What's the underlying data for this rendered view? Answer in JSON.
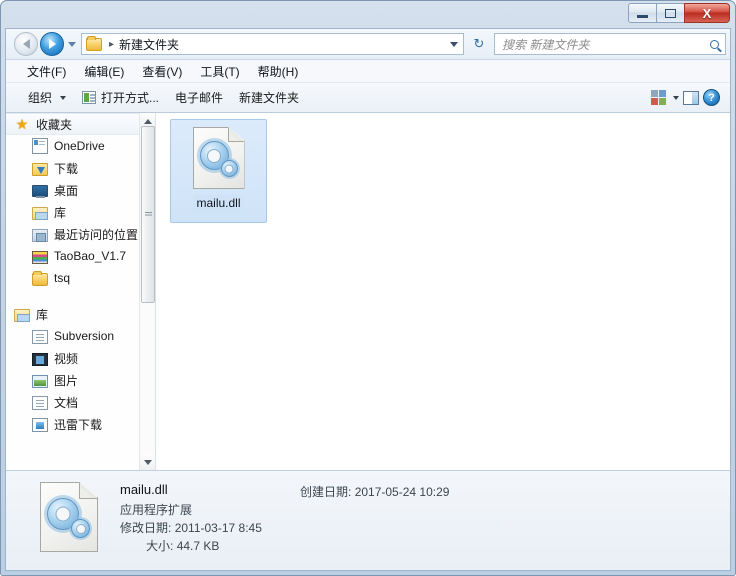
{
  "window": {
    "minimize_label": "Minimize",
    "maximize_label": "Maximize",
    "close_label": "X"
  },
  "address_bar": {
    "back_label": "Back",
    "forward_label": "Forward",
    "recent_label": "Recent pages",
    "crumb_separator": "▸",
    "path_label": "新建文件夹",
    "dropdown_label": "Previous locations",
    "refresh_label": "↻"
  },
  "search": {
    "placeholder": "搜索 新建文件夹",
    "value": ""
  },
  "menubar": {
    "items": [
      {
        "label": "文件(F)"
      },
      {
        "label": "编辑(E)"
      },
      {
        "label": "查看(V)"
      },
      {
        "label": "工具(T)"
      },
      {
        "label": "帮助(H)"
      }
    ]
  },
  "toolbar": {
    "organize_label": "组织",
    "open_with_label": "打开方式...",
    "email_label": "电子邮件",
    "new_folder_label": "新建文件夹",
    "view_options_label": "View options",
    "view_dropdown_label": "Change view",
    "preview_pane_label": "Preview pane",
    "help_label": "?"
  },
  "sidebar": {
    "favorites": {
      "header": "收藏夹",
      "items": [
        {
          "label": "OneDrive",
          "icon": "onedrive-icon"
        },
        {
          "label": "下载",
          "icon": "download-folder-icon"
        },
        {
          "label": "桌面",
          "icon": "desktop-icon"
        },
        {
          "label": "库",
          "icon": "library-icon"
        },
        {
          "label": "最近访问的位置",
          "icon": "recent-places-icon"
        },
        {
          "label": "TaoBao_V1.7",
          "icon": "taobao-icon"
        },
        {
          "label": "tsq",
          "icon": "folder-icon"
        }
      ]
    },
    "libraries": {
      "header": "库",
      "items": [
        {
          "label": "Subversion",
          "icon": "document-icon"
        },
        {
          "label": "视频",
          "icon": "video-icon"
        },
        {
          "label": "图片",
          "icon": "picture-icon"
        },
        {
          "label": "文档",
          "icon": "document-icon"
        },
        {
          "label": "迅雷下载",
          "icon": "thunder-download-icon"
        }
      ]
    },
    "scrollbar": {
      "up_label": "Scroll up",
      "down_label": "Scroll down"
    }
  },
  "content": {
    "files": [
      {
        "name": "mailu.dll",
        "icon": "dll-file-icon",
        "selected": true
      }
    ]
  },
  "details": {
    "file_name": "mailu.dll",
    "file_type": "应用程序扩展",
    "modified_label": "修改日期:",
    "modified_value": "2011-03-17 8:45",
    "size_label": "大小:",
    "size_value": "44.7 KB",
    "created_label": "创建日期:",
    "created_value": "2017-05-24 10:29"
  }
}
